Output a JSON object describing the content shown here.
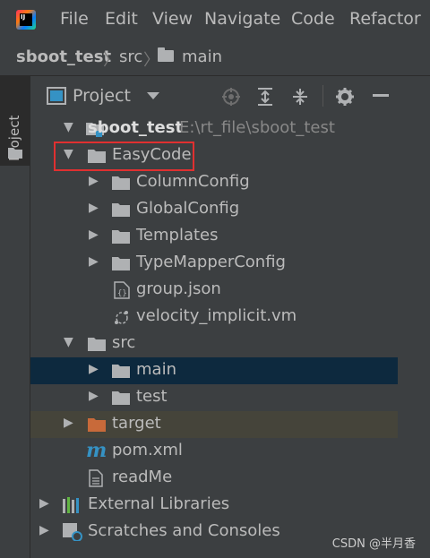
{
  "menubar": {
    "items": [
      "File",
      "Edit",
      "View",
      "Navigate",
      "Code",
      "Refactor"
    ]
  },
  "navbar": {
    "project": "sboot_test",
    "crumbs": [
      "src",
      "main"
    ]
  },
  "toolstrip": {
    "label": "Project"
  },
  "panel": {
    "title": "Project"
  },
  "tree": {
    "root_name": "sboot_test",
    "root_path": "E:\\rt_file\\sboot_test",
    "easycode": "EasyCode",
    "easycode_children": [
      "ColumnConfig",
      "GlobalConfig",
      "Templates",
      "TypeMapperConfig"
    ],
    "group_json": "group.json",
    "velocity": "velocity_implicit.vm",
    "src": "src",
    "main": "main",
    "test": "test",
    "target": "target",
    "pom": "pom.xml",
    "readme": "readMe",
    "external_libraries": "External Libraries",
    "scratches": "Scratches and Consoles"
  },
  "colors": {
    "background": "#3c3f41",
    "selected_row": "#0d293e",
    "excluded_row": "#45443a",
    "target_folder": "#c86a3a",
    "highlight_box": "#e03030"
  },
  "watermark": "CSDN @半月香"
}
